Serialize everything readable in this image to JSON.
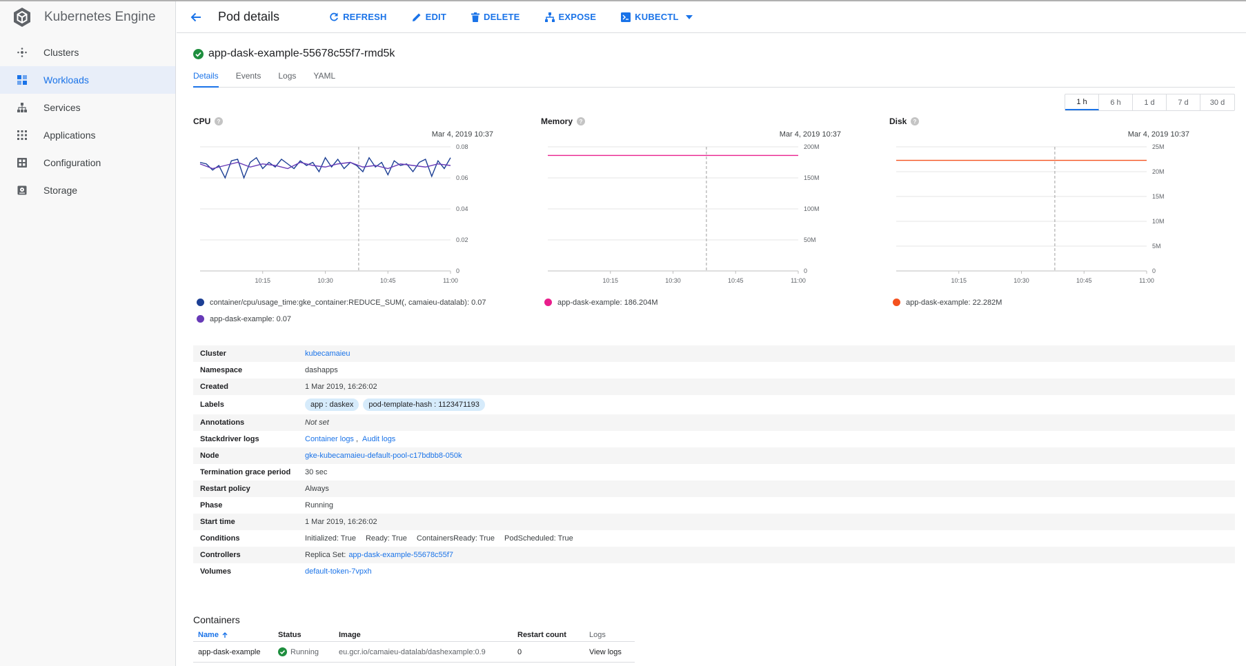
{
  "app": {
    "title": "Kubernetes Engine"
  },
  "sidebar": {
    "items": [
      {
        "label": "Clusters",
        "icon": "clusters-icon",
        "active": false
      },
      {
        "label": "Workloads",
        "icon": "workloads-icon",
        "active": true
      },
      {
        "label": "Services",
        "icon": "services-icon",
        "active": false
      },
      {
        "label": "Applications",
        "icon": "applications-icon",
        "active": false
      },
      {
        "label": "Configuration",
        "icon": "configuration-icon",
        "active": false
      },
      {
        "label": "Storage",
        "icon": "storage-icon",
        "active": false
      }
    ]
  },
  "header": {
    "title": "Pod details",
    "actions": {
      "refresh": "REFRESH",
      "edit": "EDIT",
      "delete": "DELETE",
      "expose": "EXPOSE",
      "kubectl": "KUBECTL"
    }
  },
  "pod": {
    "name": "app-dask-example-55678c55f7-rmd5k",
    "status_icon": "check-circle-icon"
  },
  "tabs": [
    "Details",
    "Events",
    "Logs",
    "YAML"
  ],
  "time_ranges": [
    "1 h",
    "6 h",
    "1 d",
    "7 d",
    "30 d"
  ],
  "colors": {
    "accent": "#1a73e8",
    "cpu_series_1": "#1c3f94",
    "cpu_series_2": "#673ab7",
    "memory": "#e91e8c",
    "disk": "#f4511e"
  },
  "charts": {
    "cpu": {
      "title": "CPU",
      "timestamp": "Mar 4, 2019 10:37",
      "legend": [
        {
          "label": "container/cpu/usage_time:gke_container:REDUCE_SUM(, camaieu-datalab): 0.07"
        },
        {
          "label": "app-dask-example: 0.07"
        }
      ]
    },
    "memory": {
      "title": "Memory",
      "timestamp": "Mar 4, 2019 10:37",
      "legend": [
        {
          "label": "app-dask-example: 186.204M"
        }
      ]
    },
    "disk": {
      "title": "Disk",
      "timestamp": "Mar 4, 2019 10:37",
      "legend": [
        {
          "label": "app-dask-example: 22.282M"
        }
      ]
    }
  },
  "chart_data": [
    {
      "type": "line",
      "title": "CPU",
      "x_ticks": [
        "10:15",
        "10:30",
        "10:45",
        "11:00"
      ],
      "y_ticks": [
        "0",
        "0.02",
        "0.04",
        "0.06",
        "0.08"
      ],
      "ylim": [
        0,
        0.08
      ],
      "xlim": [
        0,
        60
      ],
      "cursor_x": 38,
      "series": [
        {
          "name": "container/cpu/usage_time:gke_container:REDUCE_SUM(, camaieu-datalab)",
          "color": "#1c3f94",
          "x": [
            0,
            1.5,
            3,
            4.5,
            6,
            7.5,
            9,
            10.5,
            12,
            13.5,
            15,
            16.5,
            18,
            19.5,
            21,
            22.5,
            24,
            25.5,
            27,
            28.5,
            30,
            31.5,
            33,
            34.5,
            36,
            37.5,
            39,
            40.5,
            42,
            43.5,
            45,
            46.5,
            48,
            49.5,
            51,
            52.5,
            54,
            55.5,
            57,
            58.5,
            60
          ],
          "values": [
            0.07,
            0.069,
            0.065,
            0.068,
            0.06,
            0.071,
            0.072,
            0.06,
            0.07,
            0.073,
            0.066,
            0.07,
            0.067,
            0.072,
            0.069,
            0.066,
            0.071,
            0.068,
            0.07,
            0.064,
            0.073,
            0.067,
            0.072,
            0.066,
            0.07,
            0.068,
            0.064,
            0.073,
            0.067,
            0.07,
            0.062,
            0.071,
            0.068,
            0.069,
            0.064,
            0.07,
            0.072,
            0.061,
            0.071,
            0.066,
            0.073
          ]
        },
        {
          "name": "app-dask-example",
          "color": "#673ab7",
          "x": [
            0,
            3,
            6,
            9,
            12,
            15,
            18,
            21,
            24,
            27,
            30,
            33,
            36,
            39,
            42,
            45,
            48,
            51,
            54,
            57,
            60
          ],
          "values": [
            0.069,
            0.066,
            0.068,
            0.07,
            0.067,
            0.069,
            0.068,
            0.066,
            0.07,
            0.068,
            0.067,
            0.069,
            0.07,
            0.067,
            0.068,
            0.066,
            0.069,
            0.068,
            0.067,
            0.069,
            0.068
          ]
        }
      ]
    },
    {
      "type": "line",
      "title": "Memory",
      "x_ticks": [
        "10:15",
        "10:30",
        "10:45",
        "11:00"
      ],
      "y_ticks": [
        "0",
        "50M",
        "100M",
        "150M",
        "200M"
      ],
      "ylim": [
        0,
        200
      ],
      "xlim": [
        0,
        60
      ],
      "cursor_x": 38,
      "series": [
        {
          "name": "app-dask-example",
          "color": "#e91e8c",
          "x": [
            0,
            60
          ],
          "values": [
            186.204,
            186.204
          ]
        }
      ]
    },
    {
      "type": "line",
      "title": "Disk",
      "x_ticks": [
        "10:15",
        "10:30",
        "10:45",
        "11:00"
      ],
      "y_ticks": [
        "0",
        "5M",
        "10M",
        "15M",
        "20M",
        "25M"
      ],
      "ylim": [
        0,
        25
      ],
      "xlim": [
        0,
        60
      ],
      "cursor_x": 38,
      "series": [
        {
          "name": "app-dask-example",
          "color": "#f4511e",
          "x": [
            0,
            60
          ],
          "values": [
            22.282,
            22.282
          ]
        }
      ]
    }
  ],
  "details": {
    "cluster": {
      "label": "Cluster",
      "value": "kubecamaieu"
    },
    "namespace": {
      "label": "Namespace",
      "value": "dashapps"
    },
    "created": {
      "label": "Created",
      "value": "1 Mar 2019, 16:26:02"
    },
    "labels": {
      "label": "Labels",
      "chips": [
        "app : daskex",
        "pod-template-hash : 1123471193"
      ]
    },
    "annotations": {
      "label": "Annotations",
      "value": "Not set"
    },
    "stackdriver": {
      "label": "Stackdriver logs",
      "container_logs": "Container logs",
      "separator": ",",
      "audit_logs": "Audit logs"
    },
    "node": {
      "label": "Node",
      "value": "gke-kubecamaieu-default-pool-c17bdbb8-050k"
    },
    "termination": {
      "label": "Termination grace period",
      "value": "30 sec"
    },
    "restart_policy": {
      "label": "Restart policy",
      "value": "Always"
    },
    "phase": {
      "label": "Phase",
      "value": "Running"
    },
    "start_time": {
      "label": "Start time",
      "value": "1 Mar 2019, 16:26:02"
    },
    "conditions": {
      "label": "Conditions",
      "items": [
        "Initialized: True",
        "Ready: True",
        "ContainersReady: True",
        "PodScheduled: True"
      ]
    },
    "controllers": {
      "label": "Controllers",
      "prefix": "Replica Set:",
      "value": "app-dask-example-55678c55f7"
    },
    "volumes": {
      "label": "Volumes",
      "value": "default-token-7vpxh"
    }
  },
  "containers": {
    "title": "Containers",
    "columns": {
      "name": "Name",
      "status": "Status",
      "image": "Image",
      "restart_count": "Restart count",
      "logs": "Logs"
    },
    "rows": [
      {
        "name": "app-dask-example",
        "status": "Running",
        "image": "eu.gcr.io/camaieu-datalab/dashexample:0.9",
        "restart_count": "0",
        "logs": "View logs"
      }
    ]
  }
}
